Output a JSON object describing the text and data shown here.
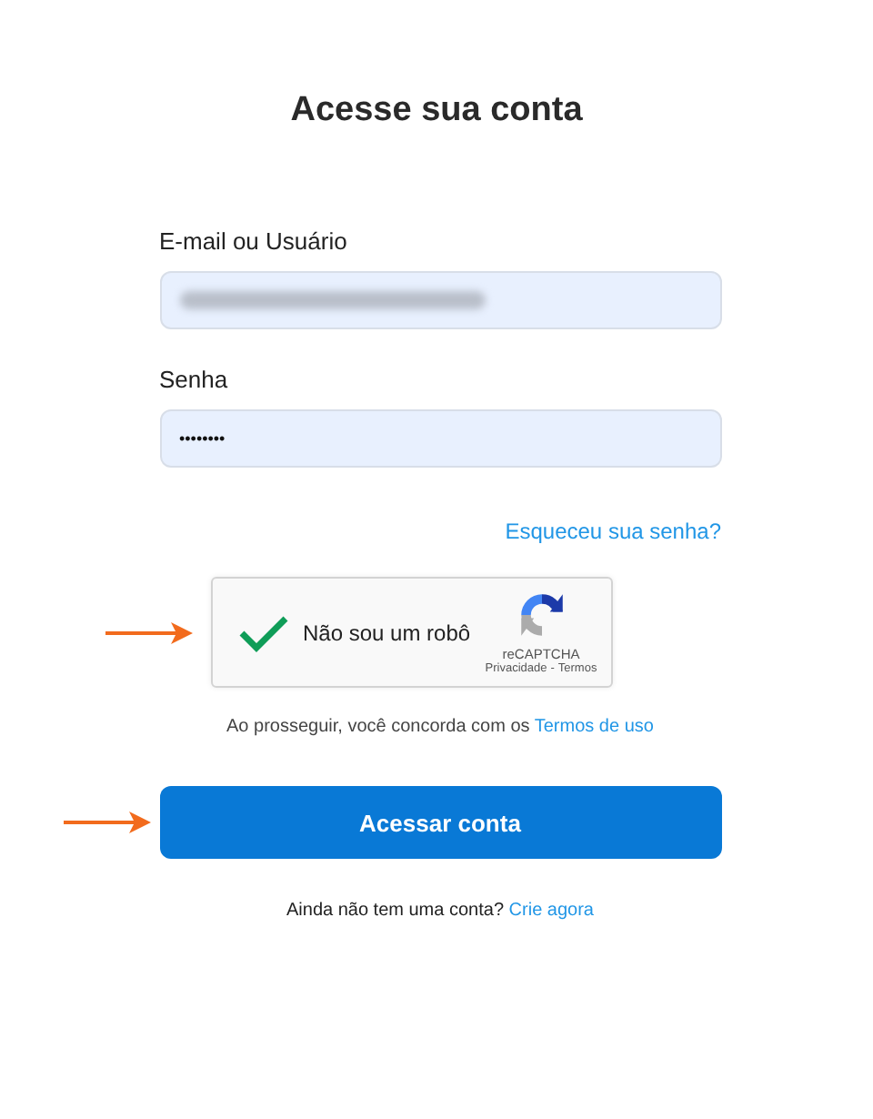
{
  "title": "Acesse sua conta",
  "fields": [
    {
      "label": "E-mail ou Usuário",
      "kind": "redacted"
    },
    {
      "label": "Senha",
      "kind": "password",
      "value": "••••••••"
    }
  ],
  "forgot_link": "Esqueceu sua senha?",
  "captcha": {
    "label": "Não sou um robô",
    "checked": true,
    "brand": "reCAPTCHA",
    "privacy": "Privacidade",
    "separator": "-",
    "terms": "Termos"
  },
  "terms_notice": {
    "text": "Ao prosseguir, você concorda com os",
    "link": "Termos de uso"
  },
  "submit": "Acessar conta",
  "signup": {
    "text": "Ainda não tem uma conta?",
    "link": "Crie agora"
  }
}
